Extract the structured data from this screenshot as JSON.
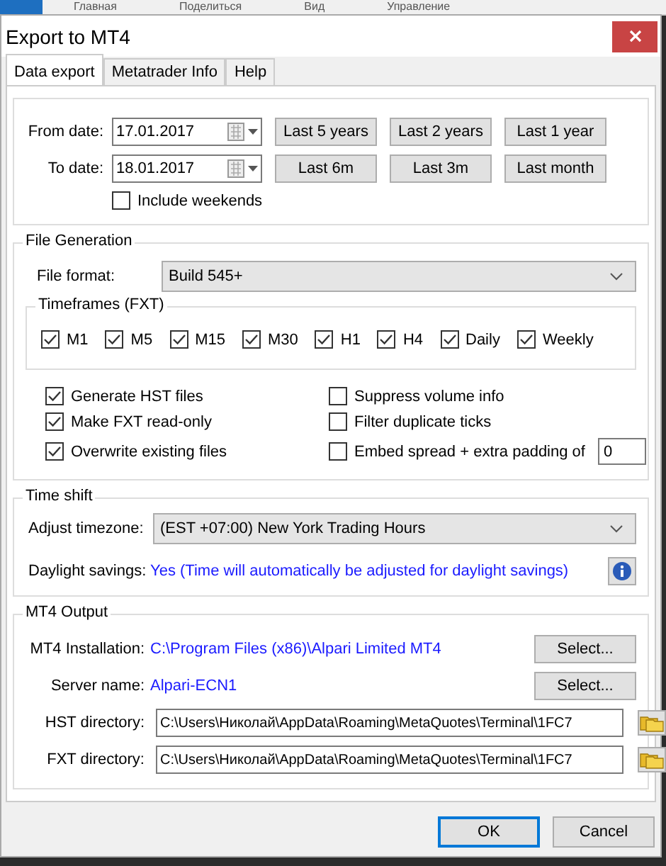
{
  "background_tabs": [
    "Главная",
    "Поделиться",
    "Вид",
    "Управление"
  ],
  "window": {
    "title": "Export to MT4"
  },
  "tabs": [
    {
      "label": "Data export",
      "selected": true
    },
    {
      "label": "Metatrader Info",
      "selected": false
    },
    {
      "label": "Help",
      "selected": false
    }
  ],
  "date_range": {
    "from": {
      "label": "From date:",
      "value": "17.01.2017"
    },
    "to": {
      "label": "To date:",
      "value": "18.01.2017"
    },
    "presets": [
      "Last 5 years",
      "Last 2 years",
      "Last 1 year",
      "Last 6m",
      "Last 3m",
      "Last month"
    ],
    "include_weekends": {
      "label": "Include weekends",
      "checked": false
    }
  },
  "file_generation": {
    "title": "File Generation",
    "file_format": {
      "label": "File format:",
      "value": "Build 545+"
    },
    "timeframes": {
      "title": "Timeframes (FXT)",
      "items": [
        {
          "label": "M1",
          "checked": true
        },
        {
          "label": "M5",
          "checked": true
        },
        {
          "label": "M15",
          "checked": true
        },
        {
          "label": "M30",
          "checked": true
        },
        {
          "label": "H1",
          "checked": true
        },
        {
          "label": "H4",
          "checked": true
        },
        {
          "label": "Daily",
          "checked": true
        },
        {
          "label": "Weekly",
          "checked": true
        }
      ]
    },
    "options": [
      {
        "kind": "checkbox",
        "label": "Generate HST files",
        "checked": true
      },
      {
        "kind": "checkbox",
        "label": "Suppress volume info",
        "checked": false
      },
      {
        "kind": "checkbox",
        "label": "Make FXT read-only",
        "checked": true
      },
      {
        "kind": "checkbox",
        "label": "Filter duplicate ticks",
        "checked": false
      },
      {
        "kind": "checkbox",
        "label": "Overwrite existing files",
        "checked": true
      },
      {
        "kind": "checkbox_input",
        "label": "Embed spread + extra padding of",
        "checked": false,
        "value": "0"
      }
    ]
  },
  "time_shift": {
    "title": "Time shift",
    "timezone": {
      "label": "Adjust timezone:",
      "value": "(EST +07:00) New York Trading Hours"
    },
    "daylight": {
      "label": "Daylight savings:",
      "value": "Yes (Time will automatically be adjusted for daylight savings)"
    }
  },
  "mt4_output": {
    "title": "MT4 Output",
    "installation": {
      "label": "MT4 Installation:",
      "value": "C:\\Program Files (x86)\\Alpari Limited MT4",
      "button": "Select..."
    },
    "server": {
      "label": "Server name:",
      "value": "Alpari-ECN1",
      "button": "Select..."
    },
    "hst": {
      "label": "HST directory:",
      "value": "C:\\Users\\Николай\\AppData\\Roaming\\MetaQuotes\\Terminal\\1FC7"
    },
    "fxt": {
      "label": "FXT directory:",
      "value": "C:\\Users\\Николай\\AppData\\Roaming\\MetaQuotes\\Terminal\\1FC7"
    }
  },
  "buttons": [
    {
      "label": "OK",
      "default": true
    },
    {
      "label": "Cancel",
      "default": false
    }
  ]
}
